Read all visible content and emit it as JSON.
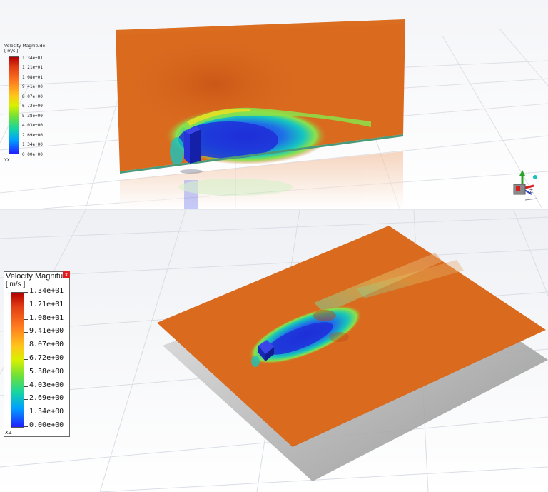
{
  "top_view": {
    "legend": {
      "title": "Velocity Magnitude",
      "units": "[ m/s ]",
      "ticks": [
        "1.34e+01",
        "1.21e+01",
        "1.08e+01",
        "9.41e+00",
        "8.07e+00",
        "6.72e+00",
        "5.38e+00",
        "4.03e+00",
        "2.69e+00",
        "1.34e+00",
        "0.00e+00"
      ],
      "axis_label": "YX"
    }
  },
  "bottom_view": {
    "legend": {
      "title": "Velocity Magnitud",
      "units": "[ m/s ]",
      "ticks": [
        "1.34e+01",
        "1.21e+01",
        "1.08e+01",
        "9.41e+00",
        "8.07e+00",
        "6.72e+00",
        "5.38e+00",
        "4.03e+00",
        "2.69e+00",
        "1.34e+00",
        "0.00e+00"
      ],
      "close_label": "x",
      "axis_label": "XZ"
    }
  },
  "colors": {
    "background": "#ffffff",
    "plane_fill": "#d96a1e",
    "low_velocity": "#1f2fd8",
    "high_velocity": "#b40000",
    "grid": "#d7dbe3"
  },
  "icons": [
    "triad-axes-icon",
    "legend-close-icon"
  ]
}
